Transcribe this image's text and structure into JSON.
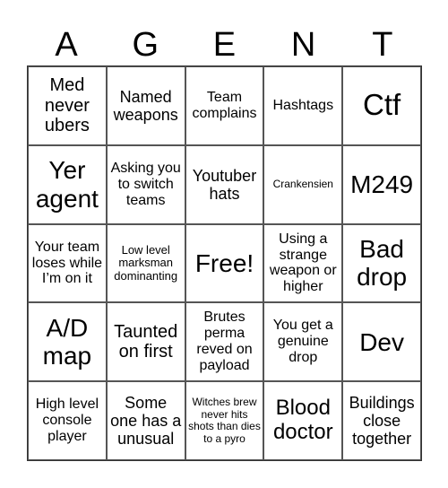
{
  "title_letters": [
    "A",
    "G",
    "E",
    "N",
    "T"
  ],
  "cells": [
    "Med never ubers",
    "Named weapons",
    "Team complains",
    "Hashtags",
    "Ctf",
    "Yer agent",
    "Asking you to switch teams",
    "Youtuber hats",
    "Crankensien",
    "M249",
    "Your team loses while I’m on it",
    "Low level marksman dominanting",
    "Free!",
    "Using a strange weapon or higher",
    "Bad drop",
    "A/D map",
    "Taunted on first",
    "Brutes perma reved on payload",
    "You get a genuine drop",
    "Dev",
    "High level console player",
    "Some one has a unusual",
    "Witches brew never hits shots than dies to a pyro",
    "Blood doctor",
    "Buildings close together"
  ]
}
